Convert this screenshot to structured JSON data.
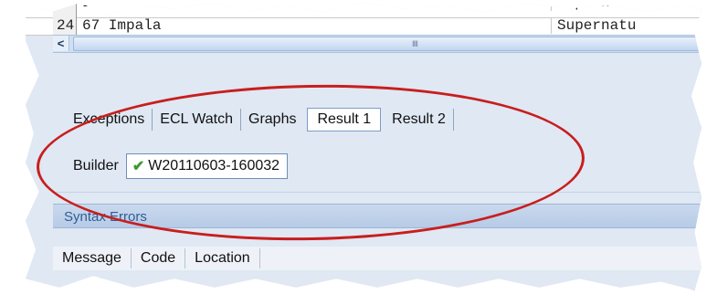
{
  "grid": {
    "rows": [
      {
        "num": "",
        "col1": "Impala",
        "col2": "Supernat"
      },
      {
        "num": "24",
        "col1": "67 Impala",
        "col2": "Supernatu"
      }
    ]
  },
  "tabs": [
    {
      "label": "Exceptions",
      "active": false
    },
    {
      "label": "ECL Watch",
      "active": false
    },
    {
      "label": "Graphs",
      "active": false
    },
    {
      "label": "Result 1",
      "active": true
    },
    {
      "label": "Result 2",
      "active": false
    }
  ],
  "builder": {
    "label": "Builder",
    "workunit": "W20110603-160032",
    "status_icon": "checkmark-icon",
    "status_color": "#3c9a2e"
  },
  "syntax_errors": {
    "title": "Syntax Errors",
    "columns": [
      "Message",
      "Code",
      "Location"
    ]
  },
  "scrollbar": {
    "left_arrow": "<",
    "grip": "IIII"
  },
  "highlight": {
    "color": "#c81e1e"
  }
}
